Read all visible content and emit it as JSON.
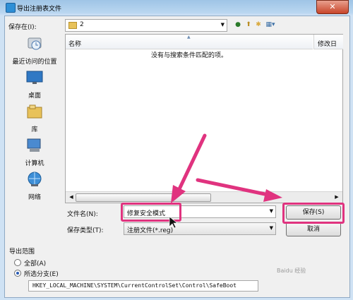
{
  "window": {
    "title": "导出注册表文件",
    "close_glyph": "✕"
  },
  "look_in": {
    "label": "保存在(I):",
    "value": "2"
  },
  "toolbar": {
    "icons": [
      "back-icon",
      "up-folder-icon",
      "new-folder-icon",
      "view-menu-icon"
    ]
  },
  "places": [
    {
      "label": "最近访问的位置",
      "icon": "recent-places-icon"
    },
    {
      "label": "桌面",
      "icon": "desktop-icon"
    },
    {
      "label": "库",
      "icon": "libraries-icon"
    },
    {
      "label": "计算机",
      "icon": "computer-icon"
    },
    {
      "label": "网络",
      "icon": "network-icon"
    }
  ],
  "file_list": {
    "columns": [
      "名称",
      "修改日"
    ],
    "empty_message": "没有与搜索条件匹配的项。"
  },
  "file_name": {
    "label": "文件名(N):",
    "value": "修复安全模式"
  },
  "file_type": {
    "label": "保存类型(T):",
    "value": "注册文件(*.reg)"
  },
  "buttons": {
    "save": "保存(S)",
    "cancel": "取消"
  },
  "export_range": {
    "title": "导出范围",
    "options": [
      {
        "label": "全部(A)",
        "selected": false
      },
      {
        "label": "所选分支(E)",
        "selected": true
      }
    ],
    "branch_value": "HKEY_LOCAL_MACHINE\\SYSTEM\\CurrentControlSet\\Control\\SafeBoot"
  },
  "watermark": "Baidu 经验",
  "colors": {
    "highlight": "#e0337f",
    "accent": "#2a5bb5"
  }
}
